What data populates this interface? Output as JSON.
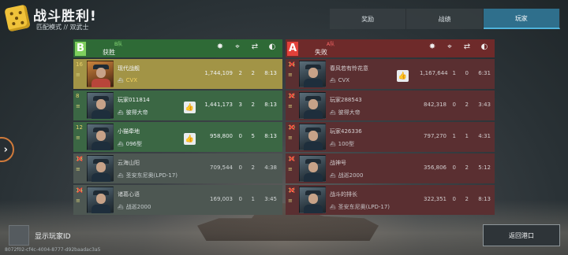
{
  "header": {
    "title": "战斗胜利!",
    "subtitle": "匹配模式 // 双武士"
  },
  "tabs": [
    {
      "label": "奖励",
      "active": false
    },
    {
      "label": "战绩",
      "active": false
    },
    {
      "label": "玩家",
      "active": true
    }
  ],
  "columns_icons": [
    "damage-icon",
    "crosshair-kill-icon",
    "handshake-assist-icon",
    "clock-icon"
  ],
  "teams": [
    {
      "letter": "B",
      "tag": "B队",
      "result": "获胜",
      "color": "#7ecf5d",
      "players": [
        {
          "level": "16",
          "name": "现代战舰",
          "ship": "CVX",
          "damage": "1,744,109",
          "kills": "2",
          "assists": "2",
          "time": "8:13",
          "dead": false,
          "liked": false,
          "highlight": true
        },
        {
          "level": "8",
          "name": "玩家011814",
          "ship": "彼得大帝",
          "damage": "1,441,173",
          "kills": "3",
          "assists": "2",
          "time": "8:13",
          "dead": false,
          "liked": true,
          "highlight": false
        },
        {
          "level": "12",
          "name": "小猫牵地",
          "ship": "096型",
          "damage": "958,800",
          "kills": "0",
          "assists": "5",
          "time": "8:13",
          "dead": false,
          "liked": true,
          "highlight": false
        },
        {
          "level": "13",
          "name": "云海山阳",
          "ship": "圣安东尼奥(LPD-17)",
          "damage": "709,544",
          "kills": "0",
          "assists": "2",
          "time": "4:38",
          "dead": true,
          "liked": false,
          "highlight": false
        },
        {
          "level": "14",
          "name": "诸葛心语",
          "ship": "战巡2000",
          "damage": "169,003",
          "kills": "0",
          "assists": "1",
          "time": "3:45",
          "dead": true,
          "liked": false,
          "highlight": false
        }
      ]
    },
    {
      "letter": "A",
      "tag": "A队",
      "result": "失败",
      "color": "#e3413a",
      "players": [
        {
          "level": "14",
          "name": "春风若有怜花意",
          "ship": "CVX",
          "damage": "1,167,644",
          "kills": "1",
          "assists": "0",
          "time": "6:31",
          "dead": true,
          "liked": true,
          "highlight": false
        },
        {
          "level": "12",
          "name": "玩家288543",
          "ship": "彼得大帝",
          "damage": "842,318",
          "kills": "0",
          "assists": "2",
          "time": "3:43",
          "dead": true,
          "liked": false,
          "highlight": false
        },
        {
          "level": "10",
          "name": "玩家426336",
          "ship": "100型",
          "damage": "797,270",
          "kills": "1",
          "assists": "1",
          "time": "4:31",
          "dead": true,
          "liked": false,
          "highlight": false
        },
        {
          "level": "11",
          "name": "战神号",
          "ship": "战巡2000",
          "damage": "356,806",
          "kills": "0",
          "assists": "2",
          "time": "5:12",
          "dead": true,
          "liked": false,
          "highlight": false
        },
        {
          "level": "12",
          "name": "战斗的排长",
          "ship": "圣安东尼奥(LPD-17)",
          "damage": "322,351",
          "kills": "0",
          "assists": "2",
          "time": "8:13",
          "dead": true,
          "liked": false,
          "highlight": false
        }
      ]
    }
  ],
  "footer": {
    "show_id_label": "显示玩家ID",
    "uuid": "8072f02-cf4c-4004-8777-d92baadac3a5",
    "back_label": "返回港口"
  }
}
